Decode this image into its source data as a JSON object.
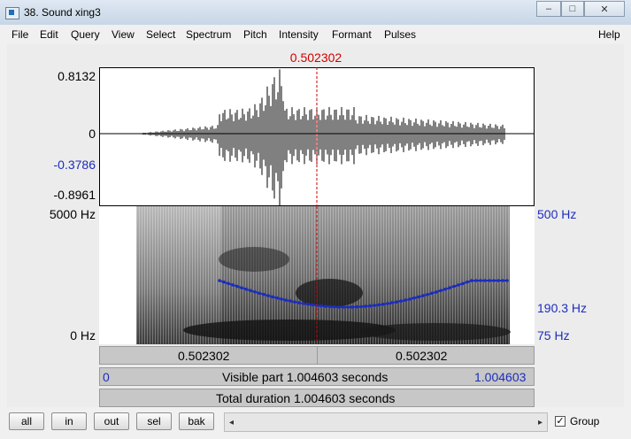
{
  "window": {
    "title": "38. Sound xing3",
    "minimize": "–",
    "maximize": "□",
    "close": "✕"
  },
  "menu": [
    "File",
    "Edit",
    "Query",
    "View",
    "Select",
    "Spectrum",
    "Pitch",
    "Intensity",
    "Formant",
    "Pulses"
  ],
  "menu_help": "Help",
  "cursor": {
    "time_label": "0.502302"
  },
  "waveform": {
    "y_max": "0.8132",
    "y_zero": "0",
    "y_cursor": "-0.3786",
    "y_min": "-0.8961"
  },
  "spectrogram": {
    "freq_top": "5000 Hz",
    "freq_bottom": "0 Hz",
    "pitch_top": "500 Hz",
    "pitch_cursor": "190.3 Hz",
    "pitch_bottom": "75 Hz"
  },
  "bars": {
    "left_time": "0.502302",
    "right_time": "0.502302",
    "visible_start": "0",
    "visible_label": "Visible part 1.004603 seconds",
    "visible_end": "1.004603",
    "total_label": "Total duration 1.004603 seconds"
  },
  "buttons": [
    "all",
    "in",
    "out",
    "sel",
    "bak"
  ],
  "scroll": {
    "left": "◂",
    "right": "▸"
  },
  "group": {
    "label": "Group",
    "checked": true,
    "check_mark": "✓"
  },
  "colors": {
    "cursor": "#d00000",
    "pitch": "#1c2dbd"
  }
}
